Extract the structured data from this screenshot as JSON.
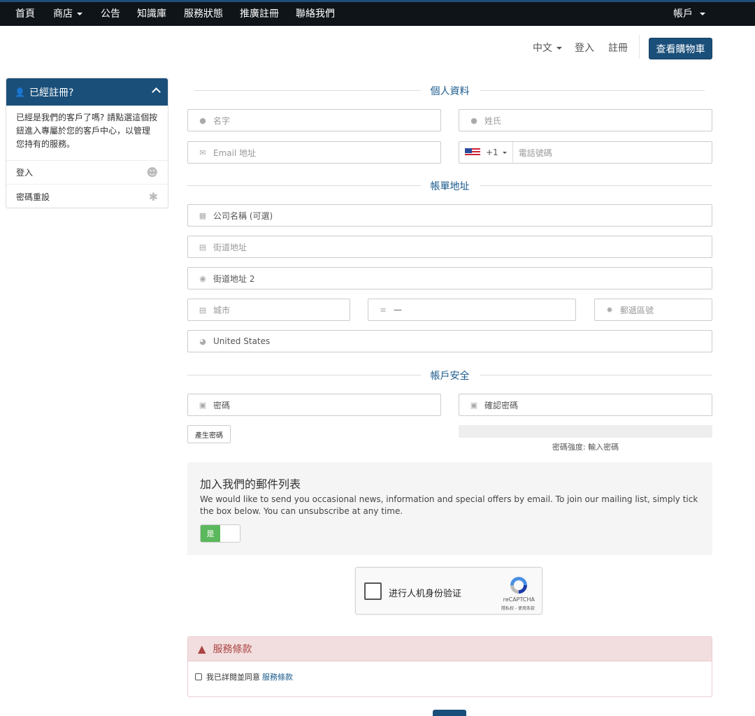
{
  "nav": {
    "home": "首頁",
    "store": "商店",
    "announcements": "公告",
    "knowledgebase": "知識庫",
    "server_status": "服務狀態",
    "affiliates": "推廣註冊",
    "contact": "聯絡我們",
    "account": "帳戶"
  },
  "header": {
    "language": "中文",
    "login": "登入",
    "register": "註冊",
    "view_cart": "查看購物車"
  },
  "sidebar": {
    "title": "已經註冊?",
    "description": "已經是我們的客戶了嗎? 請點選這個按鈕進入專屬於您的客戶中心，以管理您持有的服務。",
    "links": [
      {
        "label": "登入",
        "icon": "user-icon"
      },
      {
        "label": "密碼重設",
        "icon": "asterisk-icon"
      }
    ]
  },
  "sections": {
    "personal": "個人資料",
    "billing": "帳單地址",
    "security": "帳戶安全"
  },
  "fields": {
    "first_name": "名字",
    "last_name": "姓氏",
    "email": "Email 地址",
    "phone_code": "+1",
    "phone": "電話號碼",
    "company": "公司名稱 (可選)",
    "address1": "街道地址",
    "address2": "街道地址 2",
    "city": "城市",
    "state": "—",
    "postcode": "郵遞區號",
    "country": "United States",
    "password": "密碼",
    "confirm_password": "確認密碼"
  },
  "password": {
    "generate_label": "產生密碼",
    "strength": "密碼強度: 輸入密碼"
  },
  "mailing": {
    "title": "加入我們的郵件列表",
    "text": "We would like to send you occasional news, information and special offers by email. To join our mailing list, simply tick the box below. You can unsubscribe at any time.",
    "toggle_on": "是"
  },
  "captcha": {
    "label": "进行人机身份验证",
    "brand": "reCAPTCHA",
    "terms": "隱私权 - 使用条款"
  },
  "tos": {
    "title": "服務條款",
    "agree_text": "我已詳閱並同意",
    "link": "服務條款"
  },
  "colors": {
    "primary": "#1a4f7a",
    "nav_bg": "#0f1419",
    "success": "#5cb85c",
    "danger": "#a94442"
  }
}
